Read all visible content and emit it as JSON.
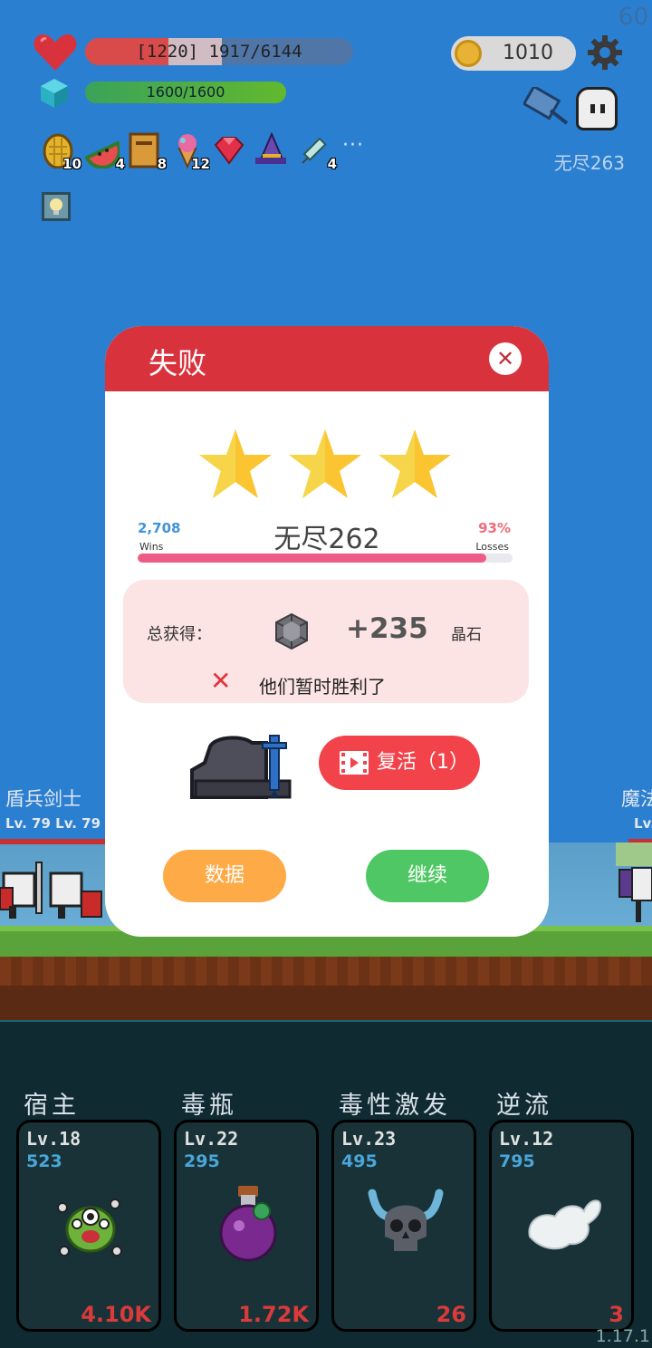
{
  "hud": {
    "fps": "60",
    "hp_text": "[1220] 1917/6144",
    "hp_fraction": 0.312,
    "shield_fraction": 0.199,
    "mp_text": "1600/1600",
    "mp_fraction": 1.0,
    "coins": "1010",
    "stage_label": "无尽263",
    "items": [
      {
        "icon": "golden-egg-icon",
        "count": "10"
      },
      {
        "icon": "watermelon-icon",
        "count": "4"
      },
      {
        "icon": "book-icon",
        "count": "8"
      },
      {
        "icon": "ice-cream-icon",
        "count": "12"
      },
      {
        "icon": "ruby-gem-icon",
        "count": ""
      },
      {
        "icon": "wizard-hat-icon",
        "count": ""
      },
      {
        "icon": "syringe-icon",
        "count": "4"
      }
    ],
    "more": "···"
  },
  "battlefield": {
    "left_unit_name": "盾兵剑士",
    "left_unit_levels": "Lv. 79 Lv. 79",
    "right_unit_name": "魔法",
    "right_unit_level": "Lv."
  },
  "dialog": {
    "title": "失败",
    "close": "✕",
    "stars": 3,
    "stage": "无尽262",
    "wins": "2,708",
    "wins_label": "Wins",
    "loss_pct": "93%",
    "loss_label": "Losses",
    "ratio_fraction": 0.93,
    "reward_label": "总获得：",
    "reward_amount": "+235",
    "reward_unit": "晶石",
    "fail_icon": "✕",
    "fail_message": "他们暂时胜利了",
    "revive_label": "复活（1）",
    "data_button": "数据",
    "continue_button": "继续"
  },
  "skills": [
    {
      "name": "宿主",
      "level": "Lv.18",
      "value": "523",
      "damage": "4.10K",
      "icon": "virus-monster-icon"
    },
    {
      "name": "毒瓶",
      "level": "Lv.22",
      "value": "295",
      "damage": "1.72K",
      "icon": "poison-bottle-icon"
    },
    {
      "name": "毒性激发",
      "level": "Lv.23",
      "value": "495",
      "damage": "26",
      "icon": "viking-skull-icon"
    },
    {
      "name": "逆流",
      "level": "Lv.12",
      "value": "795",
      "damage": "3",
      "icon": "wind-swirl-icon"
    }
  ],
  "version": "1.17.1",
  "colors": {
    "sky": "#2b7fd0",
    "dialog_header": "#d8333d",
    "data_button": "#fdaa47",
    "continue_button": "#4ec764",
    "revive_button": "#f2434b",
    "star": "#fbc531"
  }
}
